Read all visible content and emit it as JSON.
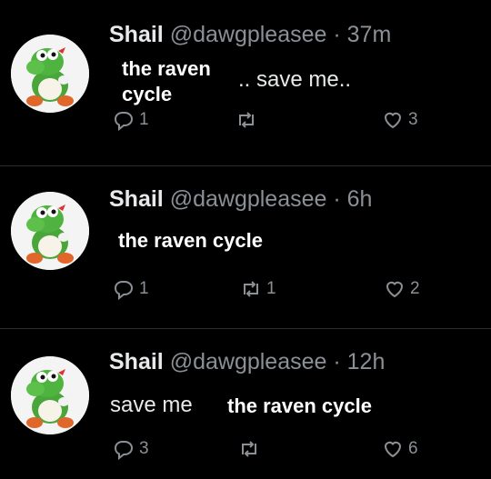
{
  "tweets": [
    {
      "name": "Shail",
      "handle": "@dawgpleasee",
      "dot": "·",
      "time": "37m",
      "overlay": "the raven cycle",
      "text": ".. save me..",
      "replies": "1",
      "retweets": "",
      "likes": "3"
    },
    {
      "name": "Shail",
      "handle": "@dawgpleasee",
      "dot": "·",
      "time": "6h",
      "overlay": "the raven cycle",
      "text": "",
      "replies": "1",
      "retweets": "1",
      "likes": "2"
    },
    {
      "name": "Shail",
      "handle": "@dawgpleasee",
      "dot": "·",
      "time": "12h",
      "overlay": "the raven cycle",
      "text": "save me",
      "replies": "3",
      "retweets": "",
      "likes": "6"
    }
  ],
  "icons": {
    "avatar": "yoshi-avatar-icon",
    "reply": "reply-icon",
    "retweet": "retweet-icon",
    "like": "heart-icon"
  },
  "colors": {
    "background": "#000000",
    "text": "#e7e9ea",
    "secondary": "#8b9096",
    "divider": "#2a2d31"
  }
}
